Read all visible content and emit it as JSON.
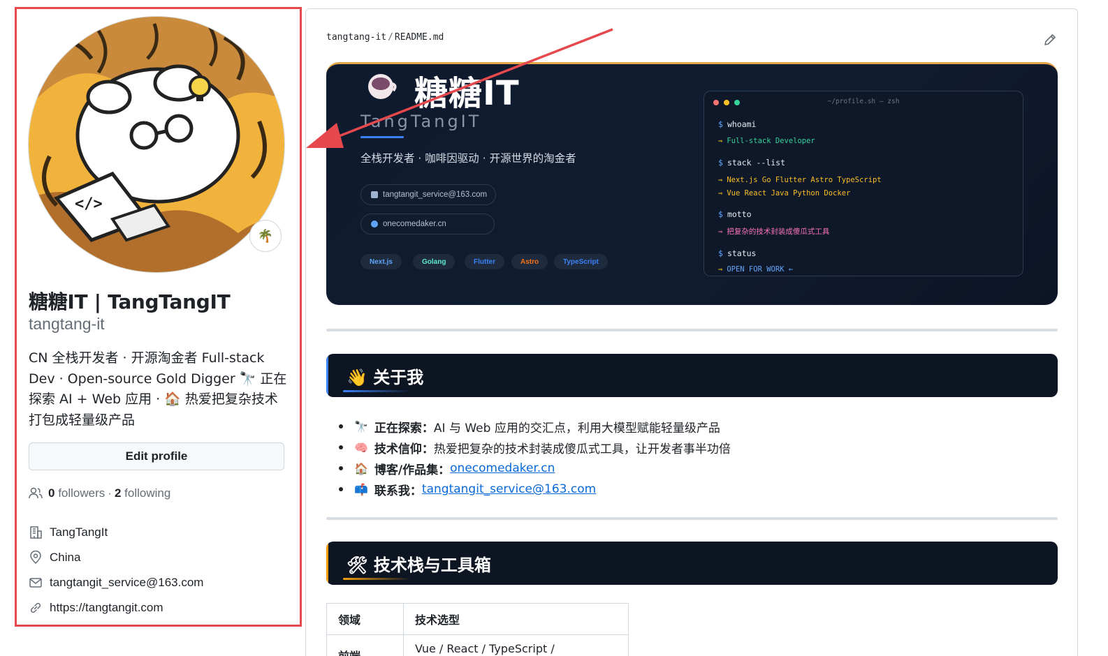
{
  "sidebar": {
    "status_emoji": "🌴",
    "display_name": "糖糖IT | TangTangIT",
    "username": "tangtang-it",
    "bio": "CN 全栈开发者 · 开源淘金者 Full-stack Dev · Open-source Gold Digger 🔭 正在探索 AI + Web 应用 · 🏠 热爱把复杂技术打包成轻量级产品",
    "edit_profile_label": "Edit profile",
    "followers_count": "0",
    "followers_label": "followers",
    "dot": "·",
    "following_count": "2",
    "following_label": "following",
    "organization": "TangTangIt",
    "location": "China",
    "email": "tangtangit_service@163.com",
    "website": "https://tangtangit.com"
  },
  "readme": {
    "owner": "tangtang-it",
    "separator": "/",
    "file": "README.md",
    "banner": {
      "title": "糖糖IT",
      "subtitle": "TangTangIT",
      "tagline": "全栈开发者 · 咖啡因驱动 · 开源世界的淘金者",
      "email_pill": "tangtangit_service@163.com",
      "site_pill": "onecomedaker.cn",
      "tags": [
        {
          "label": "Next.js",
          "color": "#60a5fa"
        },
        {
          "label": "Golang",
          "color": "#5eead4"
        },
        {
          "label": "Flutter",
          "color": "#3b82f6"
        },
        {
          "label": "Astro",
          "color": "#f97316"
        },
        {
          "label": "TypeScript",
          "color": "#3b82f6"
        }
      ],
      "terminal": {
        "title": "~/profile.sh — zsh",
        "lines": [
          {
            "kind": "cmd",
            "prompt": "$",
            "text": "whoami"
          },
          {
            "kind": "out",
            "arrow": "⇒",
            "text": "Full-stack Developer",
            "color": "#34d399"
          },
          {
            "kind": "cmd",
            "prompt": "$",
            "text": "stack --list"
          },
          {
            "kind": "out",
            "arrow": "⇒",
            "text": "Next.js Go Flutter Astro TypeScript",
            "color": "#fbbf24"
          },
          {
            "kind": "out",
            "arrow": "⇒",
            "text": "Vue React Java Python Docker",
            "color": "#fbbf24"
          },
          {
            "kind": "cmd",
            "prompt": "$",
            "text": "motto"
          },
          {
            "kind": "out",
            "arrow": "⇒",
            "text": "把复杂的技术封装成傻瓜式工具",
            "color": "#f472b6"
          },
          {
            "kind": "cmd",
            "prompt": "$",
            "text": "status"
          },
          {
            "kind": "out",
            "arrow": "⇒",
            "text": "OPEN FOR WORK ←",
            "color": "#60a5fa"
          }
        ]
      }
    },
    "about": {
      "emoji": "👋",
      "title": "关于我",
      "items": [
        {
          "emoji": "🔭",
          "label": "正在探索",
          "colon": "：",
          "text": "AI 与 Web 应用的交汇点，利用大模型赋能轻量级产品",
          "link": ""
        },
        {
          "emoji": "🧠",
          "label": "技术信仰",
          "colon": "：",
          "text": "热爱把复杂的技术封装成傻瓜式工具，让开发者事半功倍",
          "link": ""
        },
        {
          "emoji": "🏠",
          "label": "博客/作品集",
          "colon": "：",
          "text": "",
          "link": "onecomedaker.cn"
        },
        {
          "emoji": "📫",
          "label": "联系我",
          "colon": "：",
          "text": "",
          "link": "tangtangit_service@163.com"
        }
      ]
    },
    "stack_section": {
      "emoji": "🛠",
      "title": "技术栈与工具箱",
      "table_headers": [
        "领域",
        "技术选型"
      ],
      "rows": [
        [
          "前端",
          "Vue / React / TypeScript / TailwindCSS"
        ]
      ]
    }
  }
}
